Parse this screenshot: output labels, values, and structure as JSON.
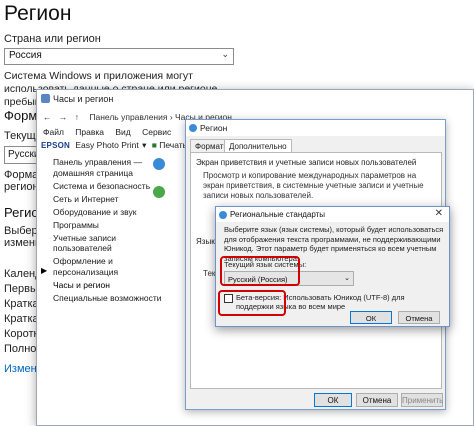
{
  "settings": {
    "title": "Регион",
    "country_label": "Страна или регион",
    "country_value": "Россия",
    "description": "Система Windows и приложения могут использовать данные о стране или регионе пребывания для предоставления",
    "formats_heading": "Форматы",
    "current_format_label": "Текущий",
    "format_value": "Русский",
    "clip_lines": [
      "Форматы",
      "региональ"
    ],
    "region_heading": "Регион",
    "region_lines": [
      "Выберите",
      "изменить"
    ],
    "calendar_lines": [
      "Календар",
      "Первый д",
      "Краткая д",
      "Краткая д",
      "Короткое",
      "Полное в"
    ],
    "link_text": "Изменить"
  },
  "control_panel": {
    "title": "Часы и регион",
    "address": "Панель управления  ›  Часы и регион",
    "menu": [
      "Файл",
      "Правка",
      "Вид",
      "Сервис"
    ],
    "epson": {
      "logo": "EPSON",
      "app": "Easy Photo Print",
      "print": "Печать"
    },
    "sidebar": [
      "Панель управления — домашняя страница",
      "Система и безопасность",
      "Сеть и Интернет",
      "Оборудование и звук",
      "Программы",
      "Учетные записи пользователей",
      "Оформление и персонализация",
      "Часы и регион",
      "Специальные возможности"
    ],
    "active_marker": "▶"
  },
  "region_dialog": {
    "title": "Регион",
    "tabs": [
      "Форматы",
      "Дополнительно"
    ],
    "group_title": "Экран приветствия и учетные записи новых пользователей",
    "group_text": "Просмотр и копирование международных параметров на экран приветствия, в системные учетные записи и учетные записи новых пользователей.",
    "group2_title": "Язык пр",
    "group2_text": "Текущ",
    "buttons": [
      "ОК",
      "Отмена",
      "Применить"
    ]
  },
  "std_dialog": {
    "title": "Региональные стандарты",
    "close": "✕",
    "description": "Выберите язык (язык системы), который будет использоваться для отображения текста программами, не поддерживающими Юникод. Этот параметр будет применяться ко всем учетным записям компьютера.",
    "current_lang_label": "Текущий язык системы:",
    "current_lang_value": "Русский (Россия)",
    "beta_label": "Бета-версия: Использовать Юникод (UTF-8) для поддержки языка во всем мире",
    "ok": "ОК",
    "cancel": "Отмена"
  },
  "colors": {
    "annotation_red": "#d40000",
    "accent_blue": "#0078d7"
  }
}
